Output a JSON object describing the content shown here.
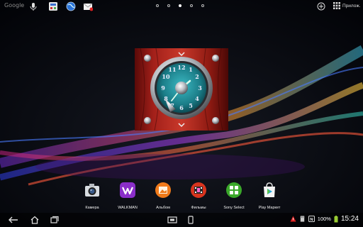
{
  "topbar": {
    "google_label": "Google",
    "apps_label": "Прилож.",
    "icons": [
      "google-logo",
      "microphone-icon",
      "settings-widget-icon",
      "browser-globe-icon",
      "email-icon",
      "add-icon",
      "apps-grid-icon"
    ],
    "page_count": 5,
    "active_page": 3
  },
  "widget": {
    "name": "analog-clock-widget",
    "dial_numbers": [
      "12",
      "1",
      "2",
      "3",
      "4",
      "5",
      "6",
      "7",
      "8",
      "9",
      "10",
      "11"
    ]
  },
  "dock": {
    "apps": [
      {
        "label": "Камера",
        "icon": "camera-icon"
      },
      {
        "label": "WALKMAN",
        "icon": "walkman-icon"
      },
      {
        "label": "Альбом",
        "icon": "album-icon"
      },
      {
        "label": "Фильмы",
        "icon": "movies-icon"
      },
      {
        "label": "Sony Select",
        "icon": "sony-select-icon"
      },
      {
        "label": "Play Маркет",
        "icon": "play-market-icon"
      }
    ]
  },
  "navbar": {
    "icons": [
      "back-icon",
      "home-icon",
      "recent-apps-icon",
      "screenshot-icon",
      "small-apps-icon"
    ],
    "status": {
      "battery_percent": "100%",
      "time": "15:24",
      "icons": [
        "warning-icon",
        "sd-card-icon",
        "nfc-icon",
        "battery-icon"
      ]
    },
    "accent_colors": {
      "warning": "#d22",
      "battery": "#9c3"
    }
  }
}
